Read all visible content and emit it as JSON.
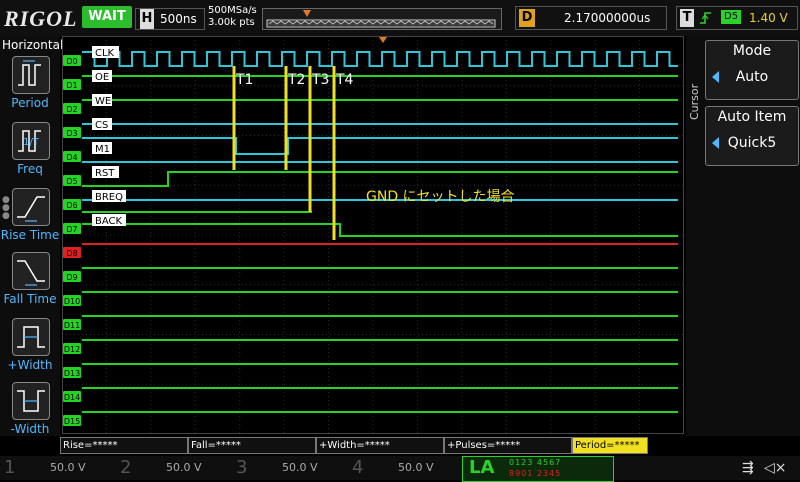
{
  "header": {
    "brand": "RIGOL",
    "run_status": "WAIT",
    "horizontal_letter": "H",
    "timebase": "500ns",
    "sample_rate": "500MSa/s",
    "memory_depth": "3.00k pts",
    "delay_letter": "D",
    "delay": "2.17000000us",
    "trigger_letter": "T",
    "trigger_edge_icon": "rising-edge-icon",
    "trigger_source": "D5",
    "trigger_level": "1.40 V"
  },
  "left_menu": {
    "title": "Horizontal",
    "items": [
      {
        "label": "Period",
        "icon": "period-icon"
      },
      {
        "label": "Freq",
        "icon": "freq-icon"
      },
      {
        "label": "Rise Time",
        "icon": "rise-time-icon"
      },
      {
        "label": "Fall Time",
        "icon": "fall-time-icon"
      },
      {
        "label": "+Width",
        "icon": "plus-width-icon"
      },
      {
        "label": "-Width",
        "icon": "minus-width-icon"
      }
    ]
  },
  "right_panel": {
    "side_label": "Cursor",
    "mode_title": "Mode",
    "mode_value": "Auto",
    "item_title": "Auto Item",
    "item_value": "Quick5"
  },
  "channels": {
    "tags": [
      "D0",
      "D1",
      "D2",
      "D3",
      "D4",
      "D5",
      "D6",
      "D7",
      "D8",
      "D9",
      "D10",
      "D11",
      "D12",
      "D13",
      "D14",
      "D15"
    ],
    "labels": [
      "CLK",
      "OE",
      "WE",
      "CS",
      "M1",
      "RST",
      "BREQ",
      "BACK"
    ]
  },
  "annotations": {
    "timing": [
      "T1",
      "T2",
      "T3",
      "T4"
    ],
    "note": "GND にセットした場合"
  },
  "measurements": [
    "Rise=*****",
    "Fall=*****",
    "+Width=*****",
    "+Pulses=*****",
    "Period=*****"
  ],
  "bottom_bar": {
    "analog": [
      {
        "num": "1",
        "scale": "50.0 V"
      },
      {
        "num": "2",
        "scale": "50.0 V"
      },
      {
        "num": "3",
        "scale": "50.0 V"
      },
      {
        "num": "4",
        "scale": "50.0 V"
      }
    ],
    "la_label": "LA",
    "la_row1": "0123 4567",
    "la_row2": "8901 2345"
  },
  "colors": {
    "digital_trace": "#23d423",
    "clock_trace": "#2fc6d8",
    "bus_trace": "#2fc6d8",
    "d8_trace": "#e02020",
    "annotation": "#f0e020",
    "accent_blue": "#4fb8ff"
  }
}
